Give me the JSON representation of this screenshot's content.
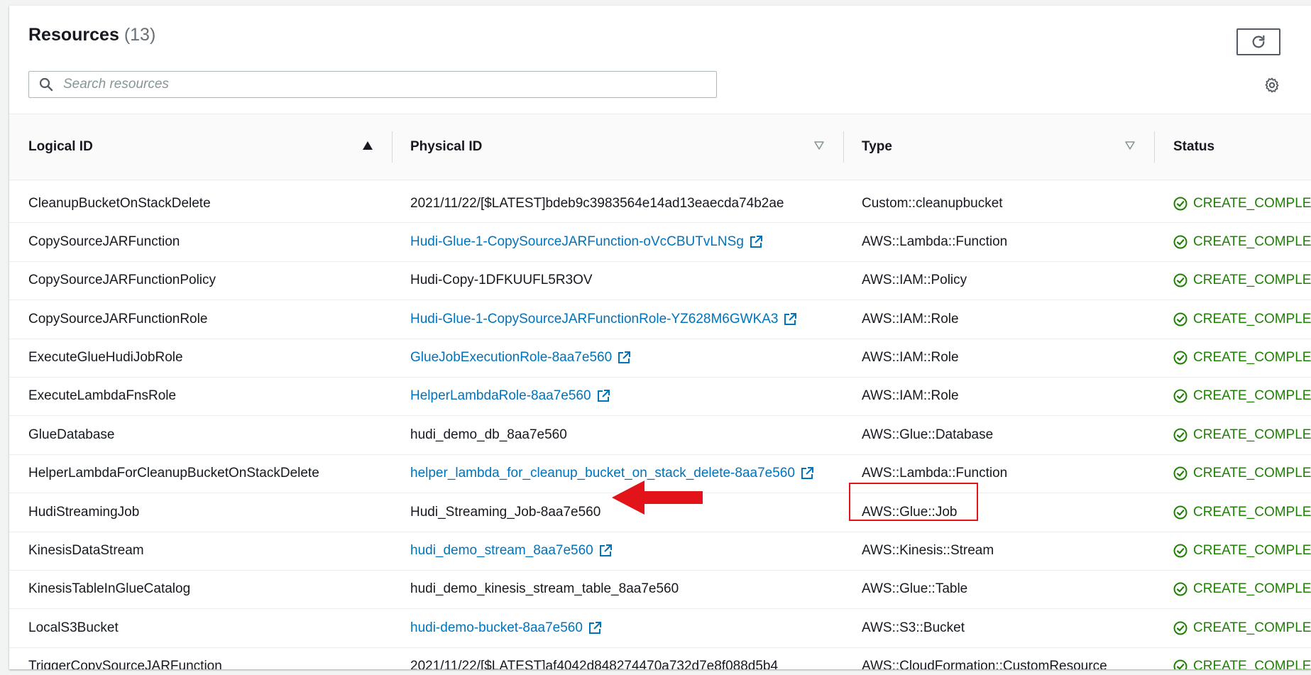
{
  "header": {
    "title": "Resources",
    "count": "(13)"
  },
  "search": {
    "placeholder": "Search resources",
    "value": ""
  },
  "columns": [
    {
      "label": "Logical ID",
      "sort": "ascending"
    },
    {
      "label": "Physical ID",
      "sort": "none"
    },
    {
      "label": "Type",
      "sort": "none"
    },
    {
      "label": "Status",
      "sort": "none"
    }
  ],
  "rows": [
    {
      "logical_id": "CleanupBucketOnStackDelete",
      "physical_id": "2021/11/22/[$LATEST]bdeb9c3983564e14ad13eaecda74b2ae",
      "physical_link": false,
      "type": "Custom::cleanupbucket",
      "status": "CREATE_COMPLETE"
    },
    {
      "logical_id": "CopySourceJARFunction",
      "physical_id": "Hudi-Glue-1-CopySourceJARFunction-oVcCBUTvLNSg",
      "physical_link": true,
      "type": "AWS::Lambda::Function",
      "status": "CREATE_COMPLETE"
    },
    {
      "logical_id": "CopySourceJARFunctionPolicy",
      "physical_id": "Hudi-Copy-1DFKUUFL5R3OV",
      "physical_link": false,
      "type": "AWS::IAM::Policy",
      "status": "CREATE_COMPLETE"
    },
    {
      "logical_id": "CopySourceJARFunctionRole",
      "physical_id": "Hudi-Glue-1-CopySourceJARFunctionRole-YZ628M6GWKA3",
      "physical_link": true,
      "type": "AWS::IAM::Role",
      "status": "CREATE_COMPLETE"
    },
    {
      "logical_id": "ExecuteGlueHudiJobRole",
      "physical_id": "GlueJobExecutionRole-8aa7e560",
      "physical_link": true,
      "type": "AWS::IAM::Role",
      "status": "CREATE_COMPLETE"
    },
    {
      "logical_id": "ExecuteLambdaFnsRole",
      "physical_id": "HelperLambdaRole-8aa7e560",
      "physical_link": true,
      "type": "AWS::IAM::Role",
      "status": "CREATE_COMPLETE"
    },
    {
      "logical_id": "GlueDatabase",
      "physical_id": "hudi_demo_db_8aa7e560",
      "physical_link": false,
      "type": "AWS::Glue::Database",
      "status": "CREATE_COMPLETE"
    },
    {
      "logical_id": "HelperLambdaForCleanupBucketOnStackDelete",
      "physical_id": "helper_lambda_for_cleanup_bucket_on_stack_delete-8aa7e560",
      "physical_link": true,
      "type": "AWS::Lambda::Function",
      "status": "CREATE_COMPLETE"
    },
    {
      "logical_id": "HudiStreamingJob",
      "physical_id": "Hudi_Streaming_Job-8aa7e560",
      "physical_link": false,
      "type": "AWS::Glue::Job",
      "status": "CREATE_COMPLETE"
    },
    {
      "logical_id": "KinesisDataStream",
      "physical_id": "hudi_demo_stream_8aa7e560",
      "physical_link": true,
      "type": "AWS::Kinesis::Stream",
      "status": "CREATE_COMPLETE"
    },
    {
      "logical_id": "KinesisTableInGlueCatalog",
      "physical_id": "hudi_demo_kinesis_stream_table_8aa7e560",
      "physical_link": false,
      "type": "AWS::Glue::Table",
      "status": "CREATE_COMPLETE"
    },
    {
      "logical_id": "LocalS3Bucket",
      "physical_id": "hudi-demo-bucket-8aa7e560",
      "physical_link": true,
      "type": "AWS::S3::Bucket",
      "status": "CREATE_COMPLETE"
    },
    {
      "logical_id": "TriggerCopySourceJARFunction",
      "physical_id": "2021/11/22/[$LATEST]af4042d848274470a732d7e8f088d5b4",
      "physical_link": false,
      "type": "AWS::CloudFormation::CustomResource",
      "status": "CREATE_COMPLETE"
    }
  ],
  "colors": {
    "link": "#0073bb",
    "success": "#1d8102",
    "annotation": "#e3131a"
  },
  "icons": {
    "search": "search-icon",
    "refresh": "refresh-icon",
    "settings": "gear-icon",
    "external": "external-link-icon",
    "status": "success-circle-icon"
  }
}
